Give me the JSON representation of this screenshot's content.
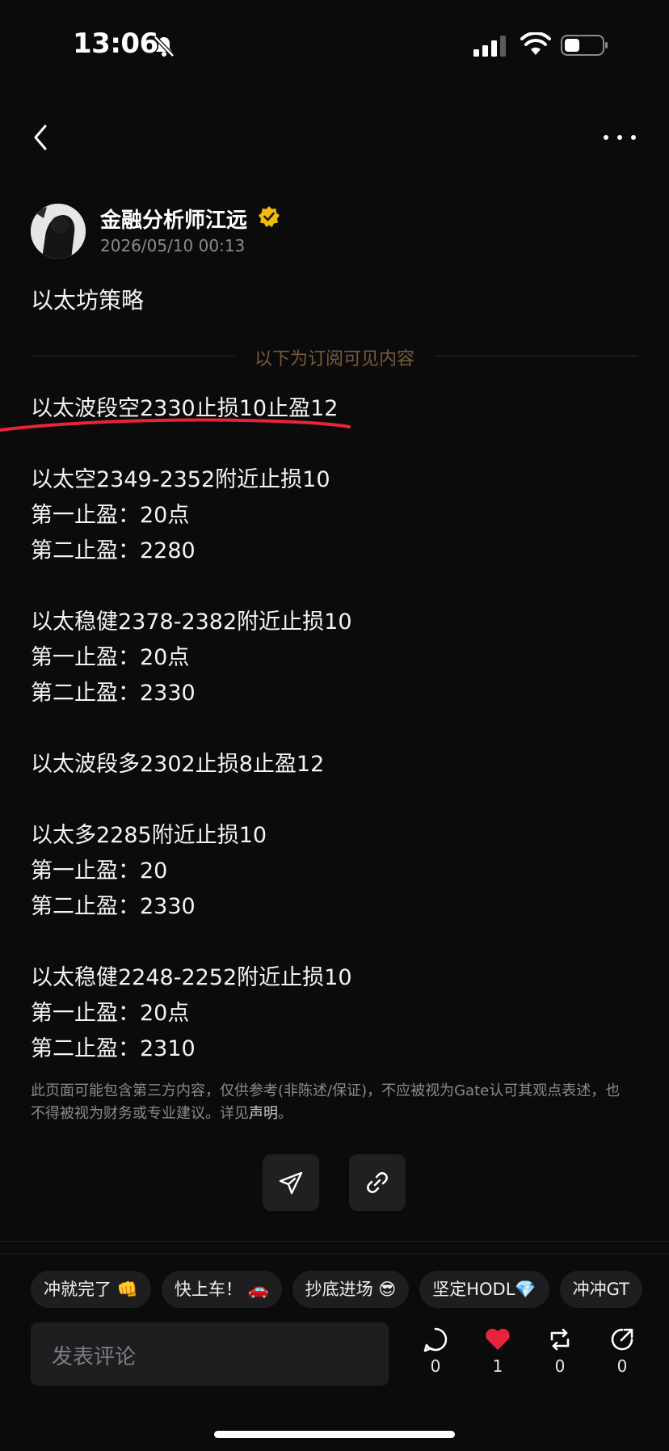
{
  "status_bar": {
    "time": "13:06"
  },
  "post": {
    "author_name": "金融分析师江远",
    "timestamp": "2026/05/10 00:13",
    "title": "以太坊策略",
    "subscription_divider": "以下为订阅可见内容",
    "lines": [
      "以太波段空2330止损10止盈12",
      "",
      "以太空2349-2352附近止损10",
      "第一止盈：20点",
      "第二止盈：2280",
      "",
      "以太稳健2378-2382附近止损10",
      "第一止盈：20点",
      "第二止盈：2330",
      "",
      "以太波段多2302止损8止盈12",
      "",
      "以太多2285附近止损10",
      "第一止盈：20",
      "第二止盈：2330",
      "",
      "以太稳健2248-2252附近止损10",
      "第一止盈：20点",
      "第二止盈：2310"
    ],
    "disclaimer_text": "此页面可能包含第三方内容，仅供参考(非陈述/保证)，不应被视为Gate认可其观点表述，也不得被视为财务或专业建议。详见",
    "disclaimer_link": "声明",
    "disclaimer_end": "。"
  },
  "quick_replies": [
    "冲就完了 👊",
    "快上车！ 🚗",
    "抄底进场 😎",
    "坚定HODL💎",
    "冲冲GT"
  ],
  "comment": {
    "placeholder": "发表评论"
  },
  "actions": {
    "comment_count": "0",
    "like_count": "1",
    "repost_count": "0",
    "share_count": "0"
  },
  "colors": {
    "background": "#0b0b0c",
    "accent_red": "#e8233a",
    "verified_gold": "#f0b90b",
    "divider_text": "#7a5a3a"
  },
  "icons": [
    "back-icon",
    "more-icon",
    "verified-icon",
    "send-icon",
    "link-icon",
    "comment-icon",
    "heart-icon",
    "repost-icon",
    "share-icon",
    "bell-off-icon",
    "signal-icon",
    "wifi-icon",
    "battery-icon"
  ]
}
